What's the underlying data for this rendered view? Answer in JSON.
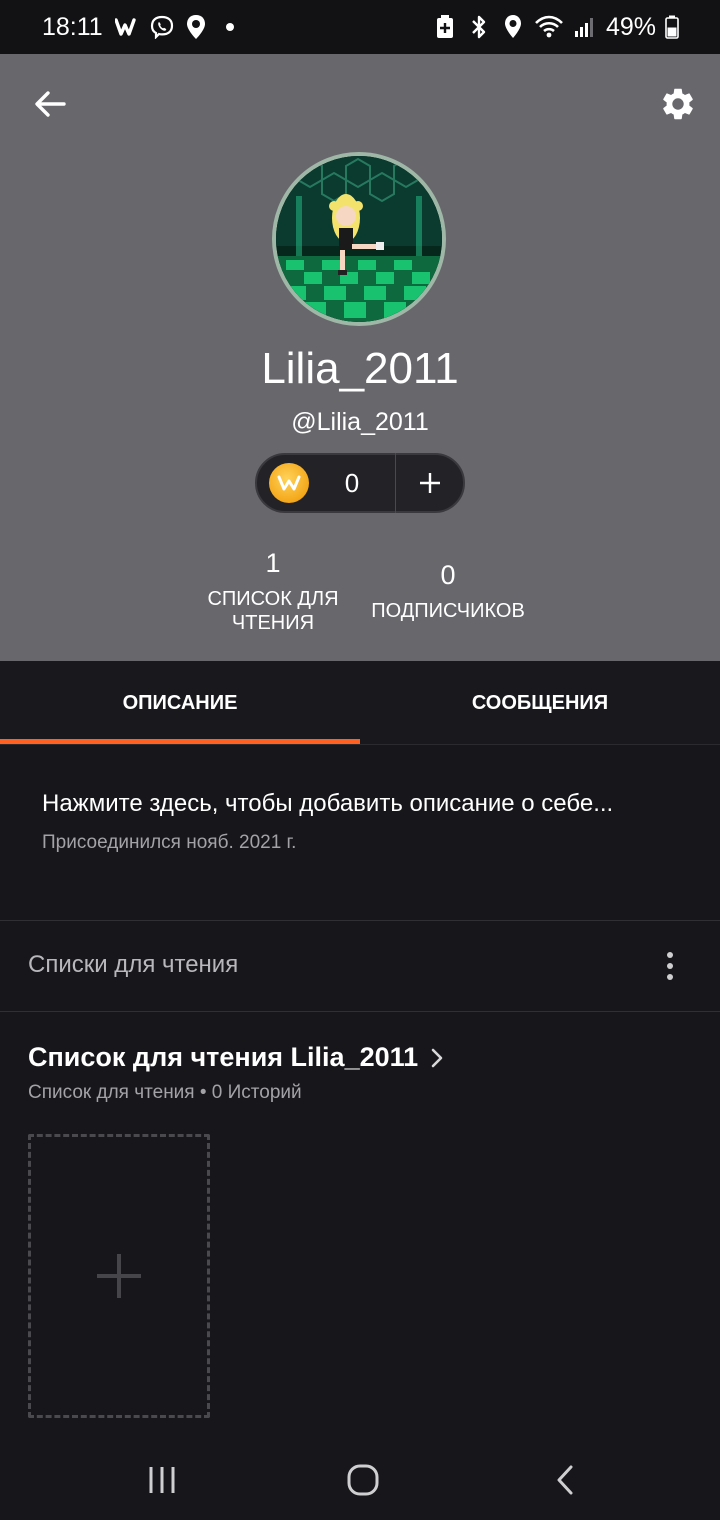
{
  "status_bar": {
    "time": "18:11",
    "battery": "49%"
  },
  "profile": {
    "display_name": "Lilia_2011",
    "handle": "@Lilia_2011",
    "coins": "0"
  },
  "stats": {
    "reading_lists_count": "1",
    "reading_lists_label_line1": "СПИСОК ДЛЯ",
    "reading_lists_label_line2": "ЧТЕНИЯ",
    "followers_count": "0",
    "followers_label": "ПОДПИСЧИКОВ"
  },
  "tabs": [
    {
      "label": "ОПИСАНИЕ",
      "active": true
    },
    {
      "label": "СООБЩЕНИЯ",
      "active": false
    }
  ],
  "about": {
    "prompt": "Нажмите здесь, чтобы добавить описание о себе...",
    "joined": "Присоединился нояб. 2021 г."
  },
  "reading_lists_section": {
    "title": "Списки для чтения",
    "list_title": "Список для чтения Lilia_2011",
    "list_subtitle": "Список для чтения • 0 Историй"
  },
  "colors": {
    "accent": "#ff6122",
    "header_bg": "#68676c",
    "page_bg": "#17161a"
  }
}
